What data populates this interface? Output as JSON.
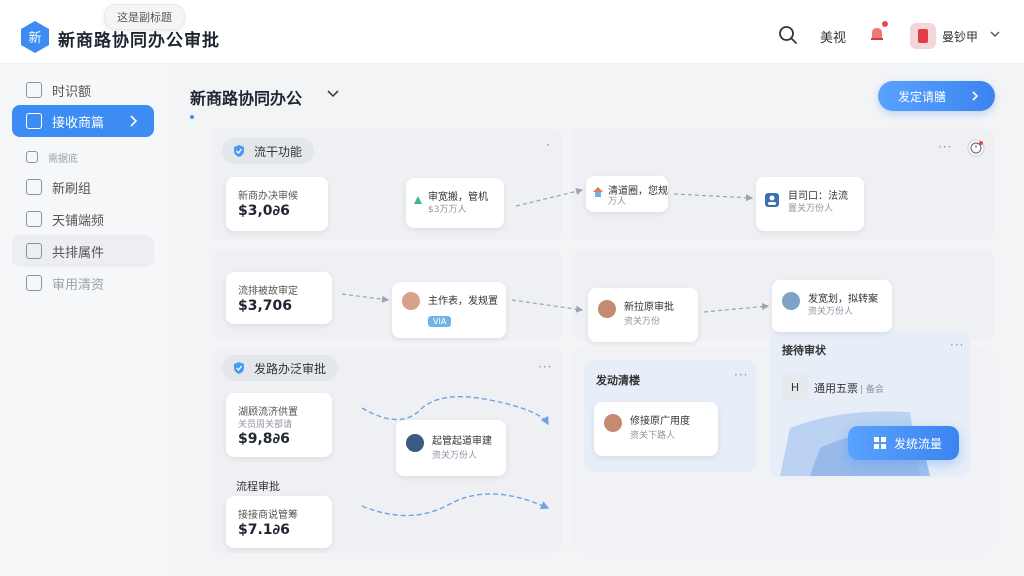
{
  "app": {
    "title": "新商路协同办公审批",
    "logo_char": "新",
    "tooltip": "这是副标题"
  },
  "topbar": {
    "link": "美视",
    "user_name": "曼钞甲"
  },
  "sidebar": {
    "items": [
      {
        "label": "时识额"
      },
      {
        "label": "接收商篇"
      },
      {
        "label": "需据底"
      },
      {
        "label": "新刷组"
      },
      {
        "label": "天铺端频"
      },
      {
        "label": "共排属件"
      },
      {
        "label": "审用清资"
      }
    ]
  },
  "main": {
    "title": "新商路协同办公",
    "primary_button": "发定请膳",
    "float_button": "发统流量",
    "sections": {
      "top_pill": "流干功能",
      "mid_pill": "发路办泛审批",
      "side_label": "流程审批",
      "right_panel_label": "发动清楼",
      "right_panel_title": "接待审状",
      "right_panel_item": "通用五票",
      "right_panel_item_sub": "| 备会"
    },
    "cards": {
      "c1": {
        "label": "新商办决审候",
        "amount": "$3,0∂6"
      },
      "c2": {
        "label": "审宽搬，管机",
        "sub": "$3万万人"
      },
      "c3": {
        "label": "清道圈，您规",
        "sub": "万人"
      },
      "c4": {
        "label": "目司口：法流",
        "sub": "置关万份人"
      },
      "c5": {
        "label": "流排被故审定",
        "amount": "$3,706"
      },
      "c6": {
        "label": "主作表，发规置",
        "tag": "VIA"
      },
      "c7": {
        "label": "新拉原审批",
        "sub": "资关万份"
      },
      "c8": {
        "label": "发宽划，拟转案",
        "sub": "资关万份人"
      },
      "c9": {
        "label": "湖顾流济供置",
        "sub": "关员周关部请",
        "amount": "$9,8∂6"
      },
      "c10": {
        "label": "起管起道审建",
        "sub": "资关万份人"
      },
      "c11": {
        "label": "修接原广用度",
        "sub": "资关下路人"
      },
      "c12": {
        "label": "接接商说管筹",
        "amount": "$7.1∂6"
      }
    }
  }
}
